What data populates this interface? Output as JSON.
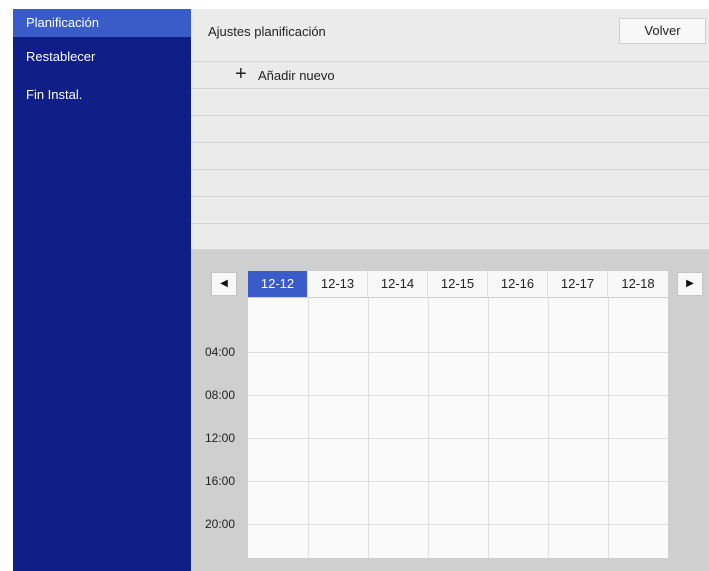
{
  "sidebar": {
    "items": [
      {
        "label": "Planificación",
        "active": true
      },
      {
        "label": "Restablecer",
        "active": false
      },
      {
        "label": "Fin Instal.",
        "active": false
      }
    ]
  },
  "header": {
    "title": "Ajustes planificación",
    "back_label": "Volver"
  },
  "list": {
    "add_icon": "+",
    "add_label": "Añadir nuevo"
  },
  "calendar": {
    "prev_icon": "◀",
    "next_icon": "▶",
    "dates": [
      "12-12",
      "12-13",
      "12-14",
      "12-15",
      "12-16",
      "12-17",
      "12-18"
    ],
    "selected_date": "12-12",
    "times": [
      "04:00",
      "08:00",
      "12:00",
      "16:00",
      "20:00"
    ]
  },
  "colors": {
    "sidebar_bg": "#0f1f87",
    "accent": "#3a5cc8",
    "panel_bg": "#ebebeb",
    "calendar_bg": "#cfcfcf"
  }
}
